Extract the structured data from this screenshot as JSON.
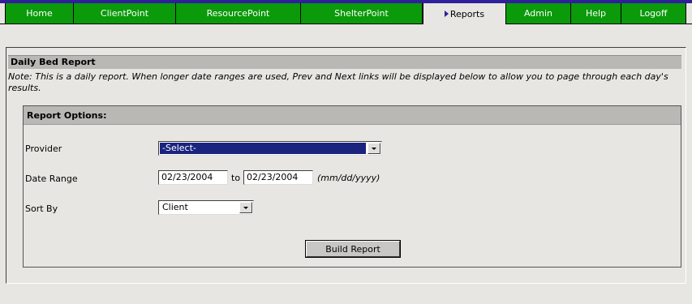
{
  "nav": {
    "tabs": [
      {
        "label": "Home"
      },
      {
        "label": "ClientPoint"
      },
      {
        "label": "ResourcePoint"
      },
      {
        "label": "ShelterPoint"
      },
      {
        "label": "Reports"
      },
      {
        "label": "Admin"
      },
      {
        "label": "Help"
      },
      {
        "label": "Logoff"
      }
    ],
    "active_tab": "Reports"
  },
  "report": {
    "title": "Daily Bed Report",
    "note": "Note: This is a daily report. When longer date ranges are used, Prev and Next links will be displayed below to allow you to page through each day's results."
  },
  "options": {
    "header": "Report Options:",
    "provider": {
      "label": "Provider",
      "value": "-Select-"
    },
    "date_range": {
      "label": "Date Range",
      "start": "02/23/2004",
      "separator": "to",
      "end": "02/23/2004",
      "hint": "(mm/dd/yyyy)"
    },
    "sort_by": {
      "label": "Sort By",
      "value": "Client"
    },
    "build_button": "Build Report"
  },
  "colors": {
    "tab_green": "#0a9a0a",
    "nav_accent": "#2f1f9a",
    "background": "#e7e6e2",
    "header_gray": "#b9b8b5",
    "select_highlight": "#1a237e"
  }
}
